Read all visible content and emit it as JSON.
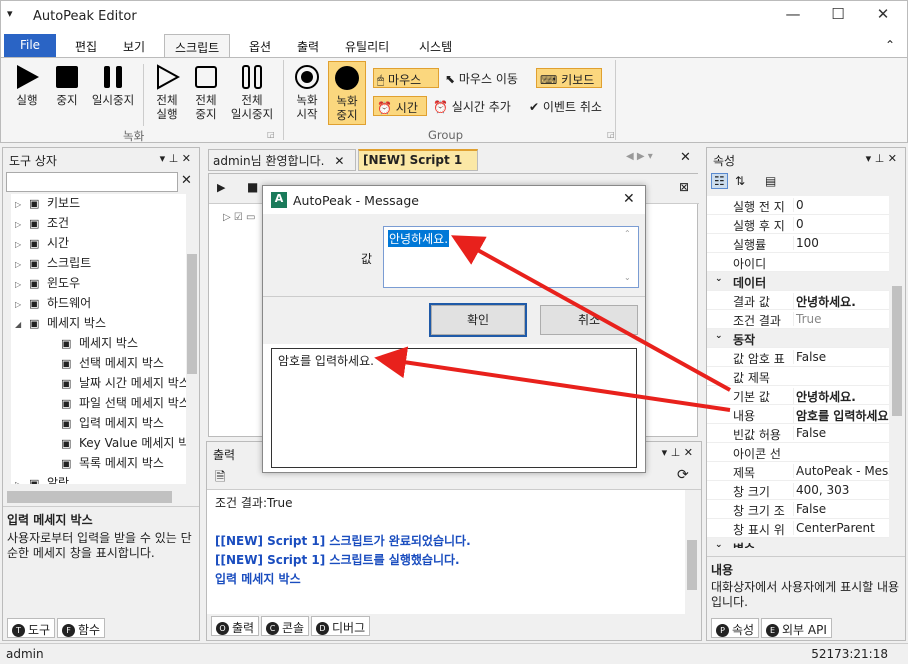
{
  "app": {
    "title": "AutoPeak Editor",
    "sysmenu": "▾",
    "min": "—",
    "max": "☐",
    "close": "✕"
  },
  "menu": {
    "tabs": [
      "File",
      "편집",
      "보기",
      "스크립트",
      "옵션",
      "출력",
      "유틸리티",
      "시스템"
    ],
    "collapse": "⌃"
  },
  "ribbon": {
    "run": "실행",
    "stop": "중지",
    "pause": "일시중지",
    "run_all_a": "전체",
    "run_all_b": "실행",
    "stop_all_a": "전체",
    "stop_all_b": "중지",
    "pause_all_a": "전체",
    "pause_all_b": "일시중지",
    "rec_start_a": "녹화",
    "rec_start_b": "시작",
    "rec_stop_a": "녹화",
    "rec_stop_b": "중지",
    "mouse": "마우스",
    "mouse_move": "마우스 이동",
    "keyboard": "키보드",
    "time": "시간",
    "realtime_add": "실시간 추가",
    "event_cancel": "이벤트 취소",
    "group_record": "녹화",
    "group_group": "Group"
  },
  "toolbox": {
    "title": "도구 상자",
    "pin": "▾  ⊥  ✕",
    "search_placeholder": "",
    "search_clear": "✕",
    "items": [
      {
        "label": "키보드",
        "exp": "▷"
      },
      {
        "label": "조건",
        "exp": "▷"
      },
      {
        "label": "시간",
        "exp": "▷"
      },
      {
        "label": "스크립트",
        "exp": "▷"
      },
      {
        "label": "윈도우",
        "exp": "▷"
      },
      {
        "label": "하드웨어",
        "exp": "▷"
      },
      {
        "label": "메세지 박스",
        "exp": "◢"
      },
      {
        "label": "메세지 박스",
        "exp": ""
      },
      {
        "label": "선택 메세지 박스",
        "exp": ""
      },
      {
        "label": "날짜 시간 메세지 박스",
        "exp": ""
      },
      {
        "label": "파일 선택 메세지 박스",
        "exp": ""
      },
      {
        "label": "입력 메세지 박스",
        "exp": ""
      },
      {
        "label": "Key Value 메세지 박스",
        "exp": ""
      },
      {
        "label": "목록 메세지 박스",
        "exp": ""
      },
      {
        "label": "알람",
        "exp": "▷"
      }
    ],
    "desc_title": "입력 메세지 박스",
    "desc_body": "사용자로부터 입력을 받을 수 있는 단순한 메세지 창을 표시합니다.",
    "tab_tools": "도구",
    "tab_funcs": "함수",
    "tab_tools_key": "T",
    "tab_funcs_key": "F"
  },
  "doc": {
    "tab1": "admin님 환영합니다.",
    "tab2": "[NEW] Script 1",
    "close": "✕"
  },
  "output": {
    "title": "출력",
    "lines": [
      {
        "text": "조건 결과:True",
        "blue": false
      },
      {
        "text": "",
        "blue": false
      },
      {
        "text": "[[NEW] Script 1] 스크립트가 완료되었습니다.",
        "blue": true
      },
      {
        "text": "[[NEW] Script 1] 스크립트를 실행했습니다.",
        "blue": true
      },
      {
        "text": "입력 메세지 박스",
        "blue": true
      }
    ],
    "tab_output": "출력",
    "tab_console": "콘솔",
    "tab_debug": "디버그",
    "key_o": "O",
    "key_c": "C",
    "key_d": "D"
  },
  "properties": {
    "title": "속성",
    "rows": [
      {
        "k": "실행 전 지",
        "v": "0",
        "cat": false
      },
      {
        "k": "실행 후 지",
        "v": "0",
        "cat": false
      },
      {
        "k": "실행률",
        "v": "100",
        "cat": false
      },
      {
        "k": "아이디",
        "v": "",
        "cat": false
      },
      {
        "k": "데이터",
        "v": "",
        "cat": true
      },
      {
        "k": "결과 값",
        "v": "안녕하세요.",
        "cat": false,
        "bold": true
      },
      {
        "k": "조건 결과",
        "v": "True",
        "cat": false,
        "gray": true
      },
      {
        "k": "동작",
        "v": "",
        "cat": true
      },
      {
        "k": "값 암호 표",
        "v": "False",
        "cat": false
      },
      {
        "k": "값 제목",
        "v": "",
        "cat": false
      },
      {
        "k": "기본 값",
        "v": "안녕하세요.",
        "cat": false,
        "bold": true
      },
      {
        "k": "내용",
        "v": "암호를 입력하세요",
        "cat": false,
        "bold": true
      },
      {
        "k": "빈값 허용",
        "v": "False",
        "cat": false
      },
      {
        "k": "아이콘 선",
        "v": "",
        "cat": false
      },
      {
        "k": "제목",
        "v": "AutoPeak - Messa",
        "cat": false
      },
      {
        "k": "창 크기",
        "v": "400, 303",
        "cat": false
      },
      {
        "k": "창 크기 조",
        "v": "False",
        "cat": false
      },
      {
        "k": "창 표시 위",
        "v": "CenterParent",
        "cat": false
      },
      {
        "k": "변수",
        "v": "",
        "cat": true
      }
    ],
    "desc_title": "내용",
    "desc_body": "대화상자에서 사용자에게 표시할 내용입니다.",
    "tab_props": "속성",
    "tab_api": "외부 API",
    "key_p": "P",
    "key_e": "E"
  },
  "dialog": {
    "title": "AutoPeak - Message",
    "close": "✕",
    "value_label": "값",
    "value": "안녕하세요.",
    "ok": "확인",
    "cancel": "취소",
    "content": "암호를 입력하세요."
  },
  "status": {
    "user": "admin",
    "time": "52173:21:18"
  },
  "colors": {
    "accent": "#2a64c5",
    "arrow": "#e8211c",
    "highlight": "#fbd77e"
  }
}
